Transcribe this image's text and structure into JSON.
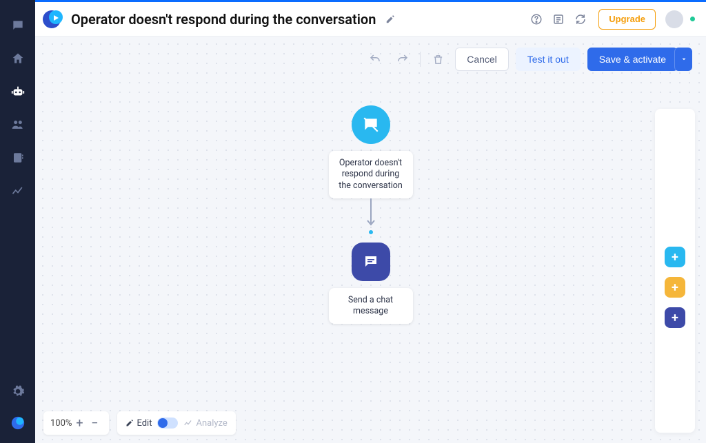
{
  "page_title": "Operator doesn't respond during the conversation",
  "header": {
    "upgrade_label": "Upgrade"
  },
  "actions": {
    "cancel": "Cancel",
    "test": "Test it out",
    "save": "Save & activate"
  },
  "flow": {
    "trigger_label": "Operator doesn't respond during the conversation",
    "action_label": "Send a chat message"
  },
  "bottom": {
    "zoom": "100%",
    "edit_label": "Edit",
    "analyze_label": "Analyze"
  }
}
